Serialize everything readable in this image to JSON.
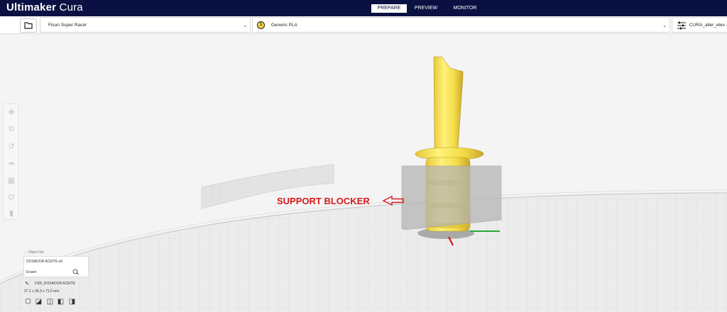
{
  "app": {
    "brand_bold": "Ultimaker",
    "brand_light": " Cura"
  },
  "stages": [
    "PREPARE",
    "PREVIEW",
    "MONITOR"
  ],
  "active_stage": "PREPARE",
  "toolbar": {
    "printer": "Flsun Super Racer",
    "material_badge": "1",
    "material": "Generic PLA",
    "profile": "CURA_ailer_elev - N"
  },
  "viewport": {
    "annotation": "SUPPORT BLOCKER"
  },
  "object_list": {
    "header": "Object list",
    "file": "DOSADOR ACEITE.stl",
    "item": "Eraser",
    "job_name": "FSR_DOSADOR ACEITE",
    "dimensions": "27.1 x 36.3 x 71.0 mm"
  },
  "colors": {
    "header_bg": "#0a1142",
    "model_yellow": "#f7e34a",
    "annotation_red": "#d71a1a",
    "blocker_grey": "#b4b4b4"
  },
  "icons": {
    "open_file": "folder-icon",
    "material": "spool-icon",
    "settings": "sliders-icon",
    "tools": [
      "move-icon",
      "scale-icon",
      "rotate-icon",
      "mirror-icon",
      "per-model-settings-icon",
      "support-blocker-icon",
      "delete-icon"
    ],
    "views": [
      "view-3d-icon",
      "view-front-icon",
      "view-top-icon",
      "view-left-icon",
      "view-right-icon"
    ]
  }
}
